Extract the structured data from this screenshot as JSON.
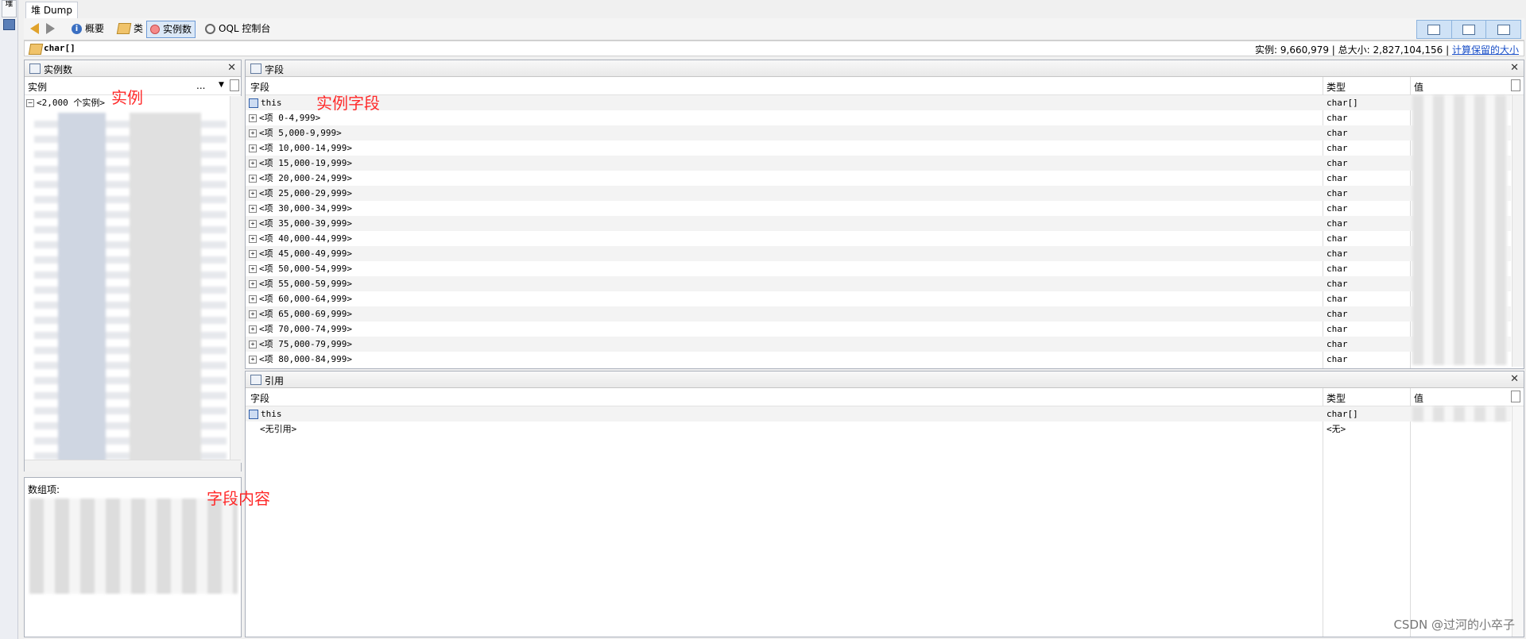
{
  "side_tab": "堆",
  "window_tab": "堆 Dump",
  "toolbar": {
    "summary": "概要",
    "classes": "类",
    "instances": "实例数",
    "oql": "OQL 控制台"
  },
  "classbar": {
    "class_name": "char[]",
    "stats_text": "实例: 9,660,979  |  总大小: 2,827,104,156  |",
    "retained_link": "计算保留的大小"
  },
  "instances_panel": {
    "title": "实例数",
    "col_instance": "实例",
    "col_more": "...",
    "root_node": "<2,000 个实例>",
    "annotation": "实例"
  },
  "array_panel": {
    "label": "数组项:",
    "annotation": "字段内容"
  },
  "fields_panel": {
    "title": "字段",
    "col_field": "字段",
    "col_type": "类型",
    "col_value": "值",
    "annotation": "实例字段",
    "rows": [
      {
        "field": "this",
        "type": "char[]"
      },
      {
        "field": "<项 0-4,999>",
        "type": "char"
      },
      {
        "field": "<项 5,000-9,999>",
        "type": "char"
      },
      {
        "field": "<项 10,000-14,999>",
        "type": "char"
      },
      {
        "field": "<项 15,000-19,999>",
        "type": "char"
      },
      {
        "field": "<项 20,000-24,999>",
        "type": "char"
      },
      {
        "field": "<项 25,000-29,999>",
        "type": "char"
      },
      {
        "field": "<项 30,000-34,999>",
        "type": "char"
      },
      {
        "field": "<项 35,000-39,999>",
        "type": "char"
      },
      {
        "field": "<项 40,000-44,999>",
        "type": "char"
      },
      {
        "field": "<项 45,000-49,999>",
        "type": "char"
      },
      {
        "field": "<项 50,000-54,999>",
        "type": "char"
      },
      {
        "field": "<项 55,000-59,999>",
        "type": "char"
      },
      {
        "field": "<项 60,000-64,999>",
        "type": "char"
      },
      {
        "field": "<项 65,000-69,999>",
        "type": "char"
      },
      {
        "field": "<项 70,000-74,999>",
        "type": "char"
      },
      {
        "field": "<项 75,000-79,999>",
        "type": "char"
      },
      {
        "field": "<项 80,000-84,999>",
        "type": "char"
      }
    ]
  },
  "references_panel": {
    "title": "引用",
    "col_field": "字段",
    "col_type": "类型",
    "col_value": "值",
    "rows": [
      {
        "field": "this",
        "type": "char[]"
      },
      {
        "field": "<无引用>",
        "type": "<无>"
      }
    ]
  },
  "watermark": "CSDN @过河的小卒子"
}
